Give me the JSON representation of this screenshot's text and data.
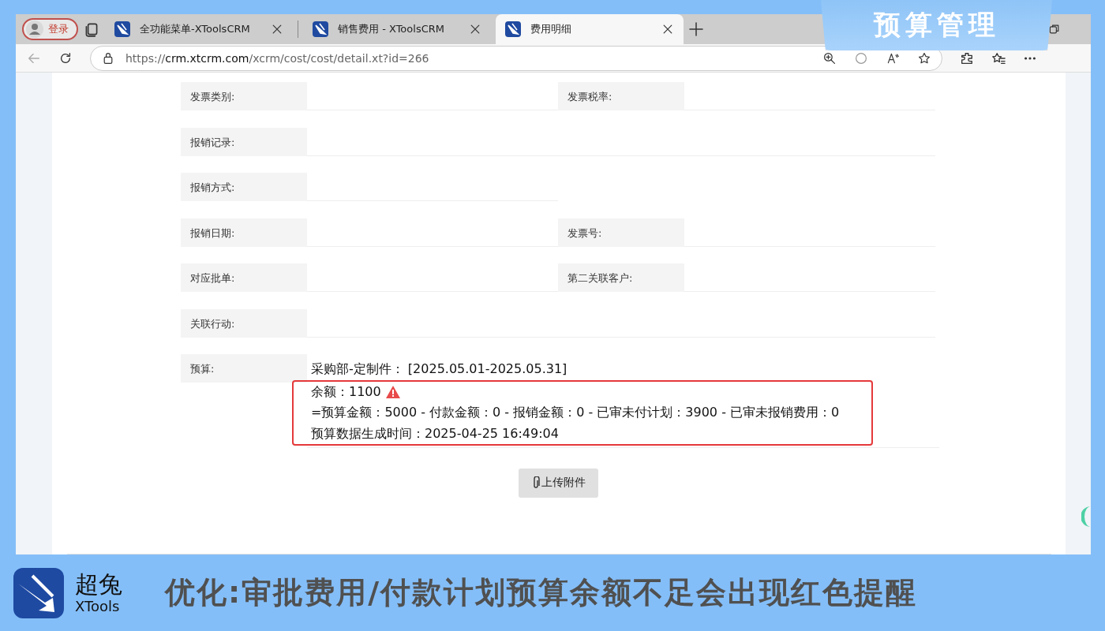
{
  "browser": {
    "profile_button": "登录",
    "tabs": [
      {
        "label": "全功能菜单-XToolsCRM",
        "selected": false
      },
      {
        "label": "销售费用 - XToolsCRM",
        "selected": false
      },
      {
        "label": "费用明细",
        "selected": true
      }
    ],
    "url": "https://**crm.xtcrm.com**/xcrm/cost/cost/detail.xt?id=266"
  },
  "form": {
    "rows": [
      {
        "kind": "pair",
        "fields": [
          "发票类别:",
          "发票税率:"
        ]
      },
      {
        "kind": "wide",
        "fields": [
          "报销记录:"
        ]
      },
      {
        "kind": "single",
        "fields": [
          "报销方式:"
        ]
      },
      {
        "kind": "pair",
        "fields": [
          "报销日期:",
          "发票号:"
        ]
      },
      {
        "kind": "pair",
        "fields": [
          "对应批单:",
          "第二关联客户:"
        ]
      },
      {
        "kind": "wide",
        "fields": [
          "关联行动:"
        ]
      }
    ],
    "budget": {
      "label": "预算:",
      "heading": "采购部-定制件：  [2025.05.01-2025.05.31]",
      "balance": "余额：1100",
      "warning": true,
      "formula": "=预算金额：5000 - 付款金额：0 - 报销金额：0 - 已审未付计划：3900 - 已审未报销费用：0",
      "generated": "预算数据生成时间：2025-04-25 16:49:04"
    },
    "upload_button": "上传附件"
  },
  "badge": "预算管理",
  "footer": {
    "brand": "超兔",
    "brand_sub": "XTools",
    "headline": "优化:审批费用/付款计划预算余额不足会出现红色提醒"
  }
}
